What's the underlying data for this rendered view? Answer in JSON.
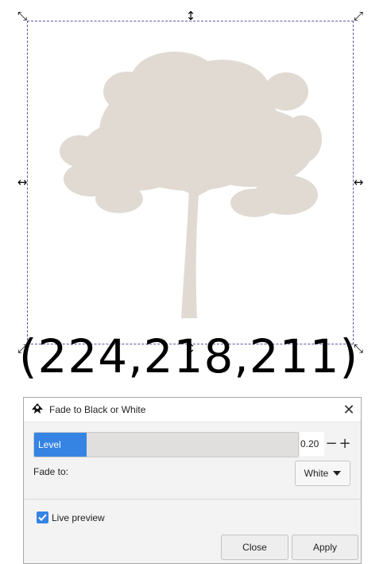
{
  "canvas": {
    "rgb_label": "(224,218,211)",
    "tree_color": "#e0dad3",
    "selection_color": "#5a5aa8"
  },
  "dialog": {
    "title": "Fade to Black or White",
    "app_icon": "inkscape-icon",
    "close_icon": "close-icon",
    "level": {
      "label": "Level",
      "value": "0.20",
      "fraction": 0.2,
      "minus": "−",
      "plus": "+"
    },
    "fade_to": {
      "label": "Fade to:",
      "selected": "White"
    },
    "live_preview": {
      "label": "Live preview",
      "checked": true
    },
    "buttons": {
      "close": "Close",
      "apply": "Apply"
    },
    "colors": {
      "accent": "#3584e4",
      "background": "#f3f3f3"
    }
  }
}
